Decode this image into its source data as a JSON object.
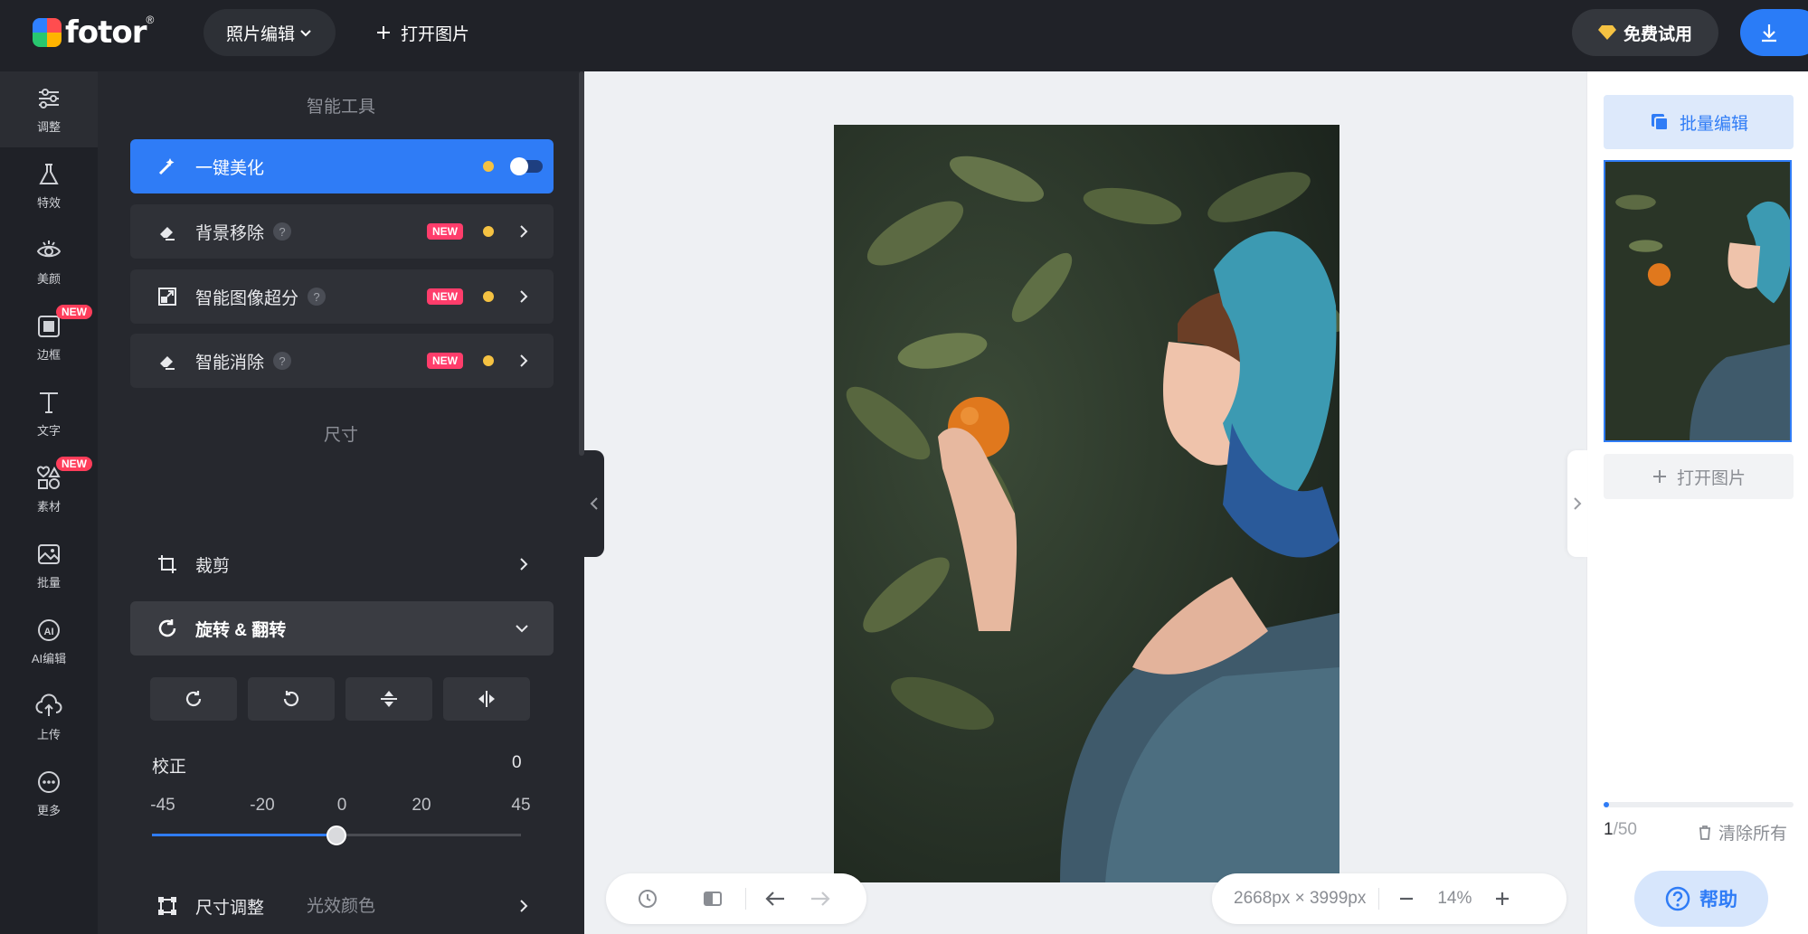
{
  "brand": {
    "name": "fotor",
    "reg": "®"
  },
  "topbar": {
    "mode_label": "照片编辑",
    "open_label": "打开图片",
    "trial_label": "免费试用"
  },
  "rail": [
    {
      "label": "调整",
      "icon": "sliders-icon",
      "active": true
    },
    {
      "label": "特效",
      "icon": "flask-icon"
    },
    {
      "label": "美颜",
      "icon": "eye-icon"
    },
    {
      "label": "边框",
      "icon": "frame-icon",
      "badge": "NEW"
    },
    {
      "label": "文字",
      "icon": "text-icon"
    },
    {
      "label": "素材",
      "icon": "shapes-icon",
      "badge": "NEW"
    },
    {
      "label": "批量",
      "icon": "batch-icon"
    },
    {
      "label": "AI编辑",
      "icon": "ai-icon"
    },
    {
      "label": "上传",
      "icon": "upload-icon"
    },
    {
      "label": "更多",
      "icon": "more-icon"
    }
  ],
  "panel": {
    "smart_tools_title": "智能工具",
    "size_title": "尺寸",
    "light_color_title": "光效颜色",
    "tools": [
      {
        "label": "一键美化",
        "icon": "magic-wand-icon"
      },
      {
        "label": "背景移除",
        "icon": "eraser-icon",
        "badge": "NEW"
      },
      {
        "label": "智能图像超分",
        "icon": "upscale-icon",
        "badge": "NEW"
      },
      {
        "label": "智能消除",
        "icon": "eraser-icon",
        "badge": "NEW"
      }
    ],
    "crop_label": "裁剪",
    "rotate_label": "旋转 & 翻转",
    "straighten_label": "校正",
    "straighten_value": "0",
    "slider_ticks": [
      "-45",
      "-20",
      "0",
      "20",
      "45"
    ],
    "slider_value_fraction": 0.5,
    "resize_label": "尺寸调整"
  },
  "canvas": {
    "dimensions": "2668px × 3999px",
    "zoom": "14%"
  },
  "right": {
    "batch_label": "批量编辑",
    "open_label": "打开图片",
    "count_current": "1",
    "count_total": "/50",
    "progress_fraction": 0.02,
    "clear_label": "清除所有",
    "help_label": "帮助"
  },
  "colors": {
    "accent": "#2f7cf6",
    "new_badge": "#ff3d6b",
    "dot": "#f5c242"
  }
}
